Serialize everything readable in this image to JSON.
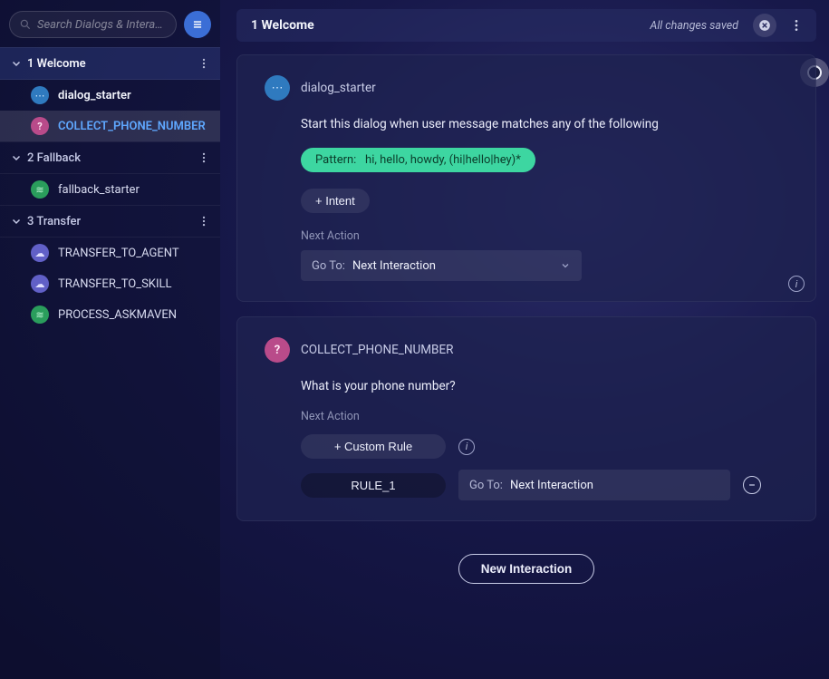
{
  "search": {
    "placeholder": "Search Dialogs & Interacti…"
  },
  "sidebar": {
    "dialogs": [
      {
        "label": "1 Welcome",
        "items": [
          {
            "icon": "ic-msg",
            "glyph": "💬",
            "label": "dialog_starter",
            "style": "ititle"
          },
          {
            "icon": "ic-q",
            "glyph": "?",
            "label": "COLLECT_PHONE_NUMBER",
            "style": "ititle link"
          }
        ]
      },
      {
        "label": "2 Fallback",
        "items": [
          {
            "icon": "ic-fb",
            "glyph": "≋",
            "label": "fallback_starter",
            "style": ""
          }
        ]
      },
      {
        "label": "3 Transfer",
        "items": [
          {
            "icon": "ic-cloud",
            "glyph": "☁",
            "label": "TRANSFER_TO_AGENT",
            "style": ""
          },
          {
            "icon": "ic-cloud",
            "glyph": "☁",
            "label": "TRANSFER_TO_SKILL",
            "style": ""
          },
          {
            "icon": "ic-fb",
            "glyph": "≋",
            "label": "PROCESS_ASKMAVEN",
            "style": ""
          }
        ]
      }
    ]
  },
  "topbar": {
    "title": "1 Welcome",
    "saved": "All changes saved"
  },
  "card1": {
    "name": "dialog_starter",
    "intro": "Start this dialog when user message matches any of the following",
    "pattern_label": "Pattern:",
    "pattern_value": "hi, hello, howdy, (hi|hello|hey)*",
    "add_intent": "+ Intent",
    "next_action_label": "Next Action",
    "goto_label": "Go To:",
    "goto_value": "Next Interaction"
  },
  "card2": {
    "name": "COLLECT_PHONE_NUMBER",
    "question": "What is your phone number?",
    "next_action_label": "Next Action",
    "custom_rule": "+ Custom Rule",
    "rule_name": "RULE_1",
    "goto_label": "Go To:",
    "goto_value": "Next Interaction"
  },
  "footer": {
    "new_interaction": "New Interaction"
  }
}
